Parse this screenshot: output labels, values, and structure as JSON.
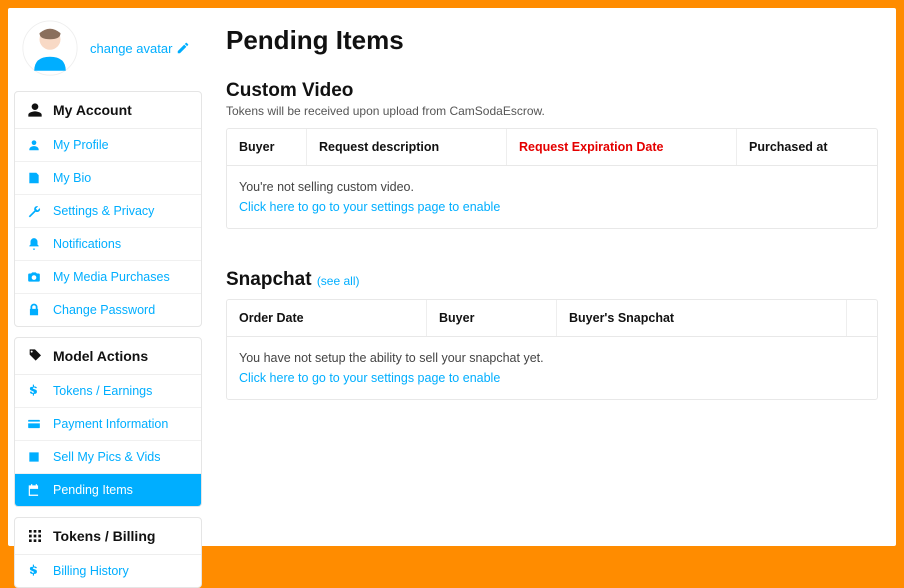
{
  "profile": {
    "change_avatar": "change avatar"
  },
  "sections": [
    {
      "title": "My Account",
      "icon": "user",
      "items": [
        {
          "label": "My Profile",
          "icon": "profile"
        },
        {
          "label": "My Bio",
          "icon": "bio"
        },
        {
          "label": "Settings & Privacy",
          "icon": "wrench"
        },
        {
          "label": "Notifications",
          "icon": "bell"
        },
        {
          "label": "My Media Purchases",
          "icon": "camera"
        },
        {
          "label": "Change Password",
          "icon": "lock"
        }
      ]
    },
    {
      "title": "Model Actions",
      "icon": "tag",
      "items": [
        {
          "label": "Tokens / Earnings",
          "icon": "dollar"
        },
        {
          "label": "Payment Information",
          "icon": "card"
        },
        {
          "label": "Sell My Pics & Vids",
          "icon": "image"
        },
        {
          "label": "Pending Items",
          "icon": "calendar",
          "active": true
        }
      ]
    },
    {
      "title": "Tokens / Billing",
      "icon": "grid",
      "items": [
        {
          "label": "Billing History",
          "icon": "dollar"
        }
      ]
    }
  ],
  "page": {
    "title": "Pending Items"
  },
  "custom_video": {
    "title": "Custom Video",
    "desc": "Tokens will be received upon upload from CamSodaEscrow.",
    "cols": {
      "buyer": "Buyer",
      "request": "Request description",
      "expire": "Request Expiration Date",
      "purchased": "Purchased at"
    },
    "empty_msg": "You're not selling custom video.",
    "enable_link": "Click here to go to your settings page to enable"
  },
  "snapchat": {
    "title": "Snapchat",
    "see_all": "(see all)",
    "cols": {
      "order_date": "Order Date",
      "buyer": "Buyer",
      "buyers_snapchat": "Buyer's Snapchat"
    },
    "empty_msg": "You have not setup the ability to sell your snapchat yet.",
    "enable_link": "Click here to go to your settings page to enable"
  }
}
